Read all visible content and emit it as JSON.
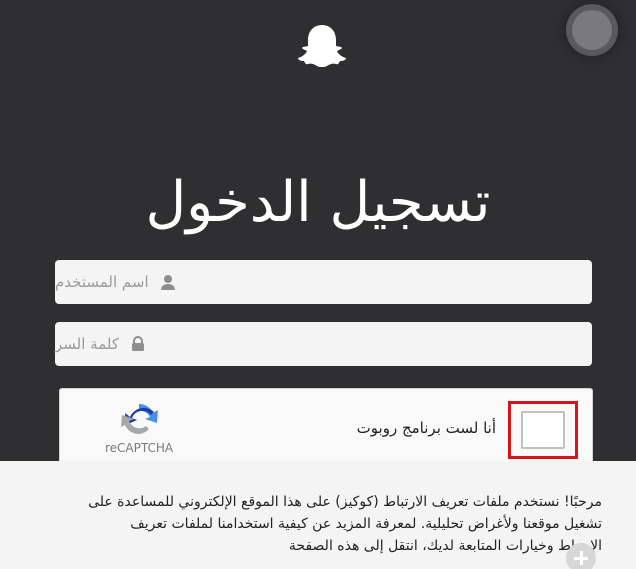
{
  "header": {
    "logo_icon": "ghost-icon",
    "title": "تسجيل الدخول"
  },
  "form": {
    "username_placeholder": "اسم المستخدم",
    "username_icon": "user-icon",
    "password_placeholder": "كلمة السر",
    "password_icon": "lock-icon"
  },
  "captcha": {
    "label": "أنا لست برنامج روبوت",
    "brand": "reCAPTCHA",
    "checked": false,
    "highlight_color": "#d8141b"
  },
  "cookie_notice": {
    "text": "مرحبًا! نستخدم ملفات تعريف الارتباط (كوكيز) على هذا الموقع الإلكتروني للمساعدة على تشغيل موقعنا ولأغراض تحليلية. لمعرفة المزيد عن كيفية استخدامنا لملفات تعريف الارتباط وخيارات المتابعة لديك، انتقل إلى هذه الصفحة",
    "expand_icon": "plus-icon"
  },
  "colors": {
    "background": "#2f2f31",
    "field_bg": "#f4f4f4",
    "link": "#2a5db0"
  }
}
